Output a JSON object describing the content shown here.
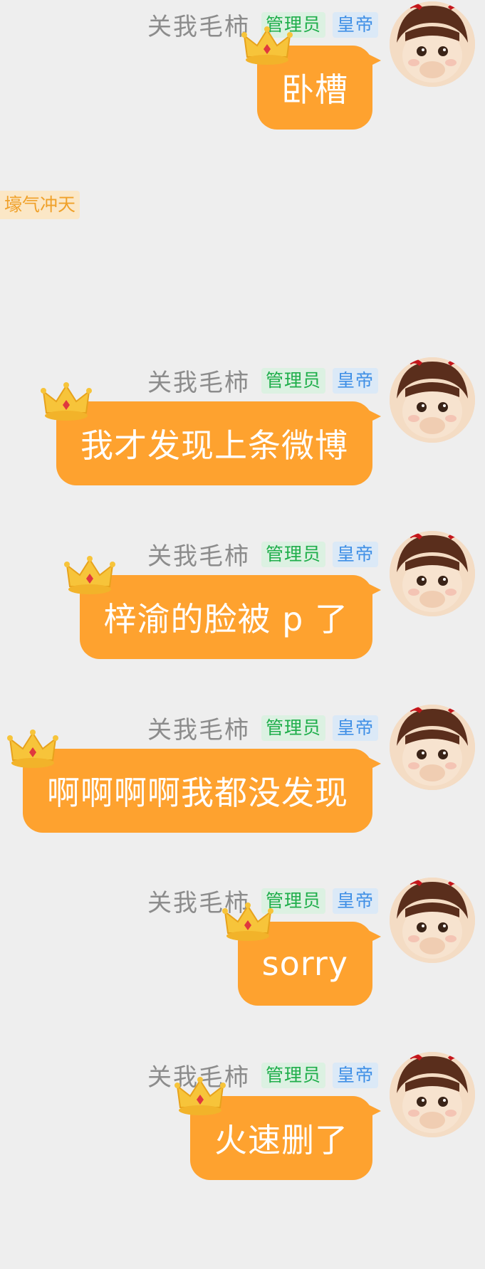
{
  "colors": {
    "bubble": "#fea22f",
    "admin_badge": "#1fae4b",
    "emperor_badge": "#3f8fe6",
    "page_bg": "#eeeeee"
  },
  "status_tag": "壕气冲天",
  "messages": [
    {
      "sender": "关我毛柿",
      "badge_admin": "管理员",
      "badge_emperor": "皇帝",
      "text": "卧槽",
      "avatar": "cartoon-girl-avatar",
      "decoration": "crown-icon"
    },
    {
      "sender": "关我毛柿",
      "badge_admin": "管理员",
      "badge_emperor": "皇帝",
      "text": "我才发现上条微博",
      "avatar": "cartoon-girl-avatar",
      "decoration": "crown-icon"
    },
    {
      "sender": "关我毛柿",
      "badge_admin": "管理员",
      "badge_emperor": "皇帝",
      "text": "梓渝的脸被 p 了",
      "avatar": "cartoon-girl-avatar",
      "decoration": "crown-icon"
    },
    {
      "sender": "关我毛柿",
      "badge_admin": "管理员",
      "badge_emperor": "皇帝",
      "text": "啊啊啊啊我都没发现",
      "avatar": "cartoon-girl-avatar",
      "decoration": "crown-icon"
    },
    {
      "sender": "关我毛柿",
      "badge_admin": "管理员",
      "badge_emperor": "皇帝",
      "text": "sorry",
      "avatar": "cartoon-girl-avatar",
      "decoration": "crown-icon"
    },
    {
      "sender": "关我毛柿",
      "badge_admin": "管理员",
      "badge_emperor": "皇帝",
      "text": "火速删了",
      "avatar": "cartoon-girl-avatar",
      "decoration": "crown-icon"
    }
  ]
}
